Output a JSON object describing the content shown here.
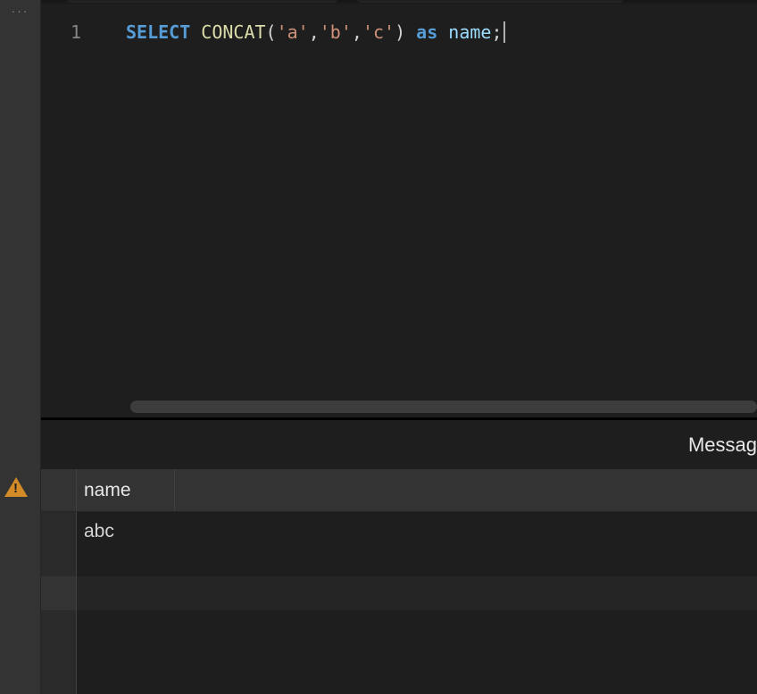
{
  "activity": {
    "dots": "···"
  },
  "editor": {
    "line_number": "1",
    "tokens": {
      "select": "SELECT",
      "concat": "CONCAT",
      "lparen": "(",
      "str_a": "'a'",
      "comma1": ",",
      "str_b": "'b'",
      "comma2": ",",
      "str_c": "'c'",
      "rparen": ")",
      "as": "as",
      "ident": "name",
      "semi": ";"
    }
  },
  "results": {
    "tab_messages": "Messag",
    "columns": [
      "name"
    ],
    "rows": [
      {
        "name": "abc"
      }
    ]
  }
}
